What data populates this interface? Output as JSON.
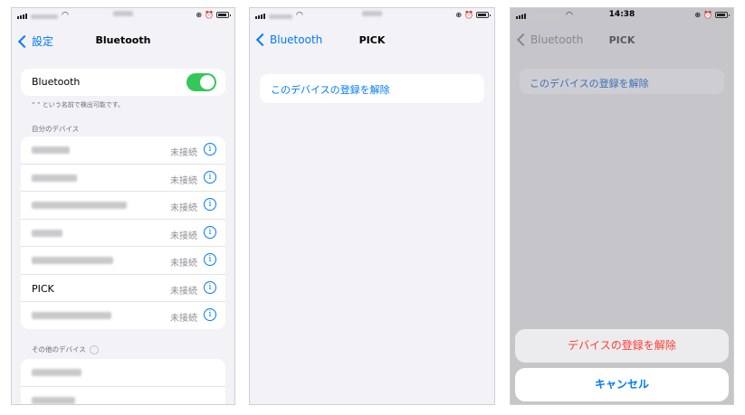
{
  "panel1": {
    "back_label": "設定",
    "title": "Bluetooth",
    "toggle_label": "Bluetooth",
    "toggle_on": true,
    "discoverable_text": "“ ” という名前で検出可能です。",
    "my_devices_header": "自分のデバイス",
    "devices": [
      {
        "name": "",
        "status": "未接続"
      },
      {
        "name": "",
        "status": "未接続"
      },
      {
        "name": "",
        "status": "未接続"
      },
      {
        "name": "",
        "status": "未接続"
      },
      {
        "name": "",
        "status": "未接続"
      },
      {
        "name": "PICK",
        "status": "未接続"
      },
      {
        "name": "",
        "status": "未接続"
      }
    ],
    "other_devices_header": "その他のデバイス"
  },
  "panel2": {
    "back_label": "Bluetooth",
    "title": "PICK",
    "forget_label": "このデバイスの登録を解除"
  },
  "panel3": {
    "time": "14:38",
    "back_label": "Bluetooth",
    "title": "PICK",
    "forget_label": "このデバイスの登録を解除",
    "action_label": "デバイスの登録を解除",
    "cancel_label": "キャンセル"
  },
  "colors": {
    "accent": "#007aff",
    "destructive": "#ff3b30",
    "switch_on": "#34c759"
  },
  "icons": [
    "signal-icon",
    "wifi-icon",
    "battery-icon",
    "chevron-left-icon",
    "info-icon",
    "spinner-icon"
  ]
}
